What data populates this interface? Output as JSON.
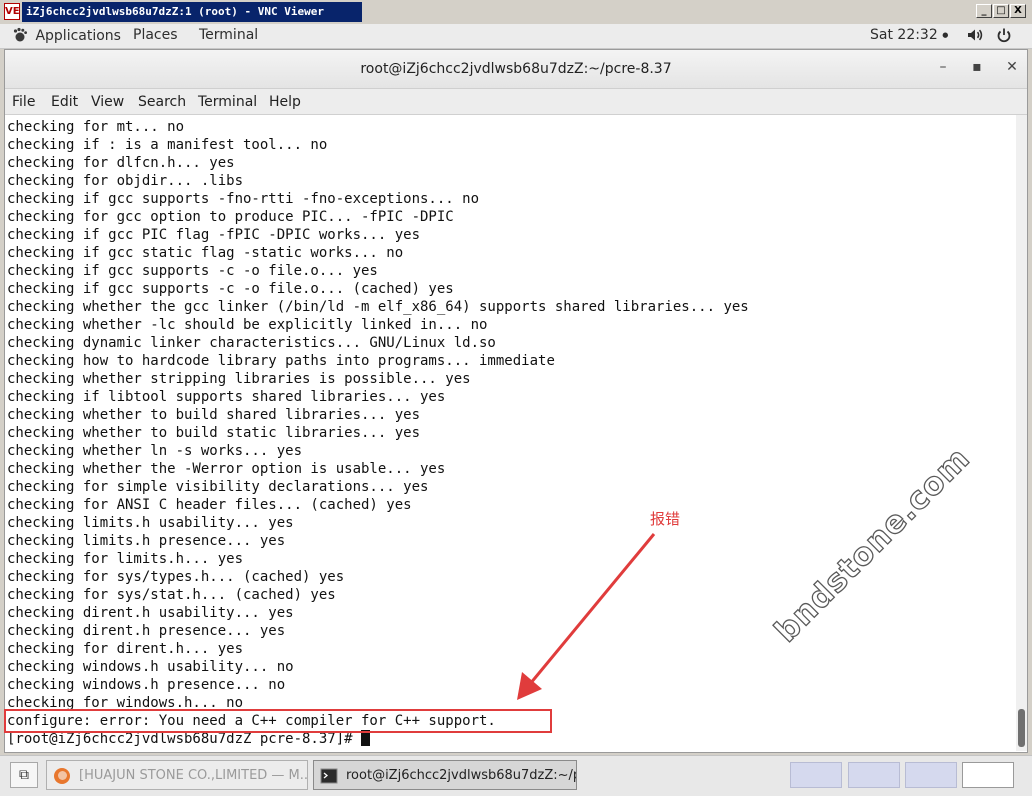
{
  "vnc": {
    "title": "iZj6chcc2jvdlwsb68u7dzZ:1 (root) - VNC Viewer",
    "icon_text": "VE",
    "buttons": {
      "minimize": "_",
      "maximize": "□",
      "close": "X"
    }
  },
  "gnome": {
    "applications": "Applications",
    "places": "Places",
    "terminal": "Terminal",
    "clock": "Sat 22:32",
    "clock_arrow": "●",
    "volume_icon": "🔊",
    "power_icon": "⏻"
  },
  "window": {
    "title": "root@iZj6chcc2jvdlwsb68u7dzZ:~/pcre-8.37",
    "controls": {
      "minimize": "–",
      "maximize": "▪",
      "close": "✕"
    }
  },
  "menu": [
    "File",
    "Edit",
    "View",
    "Search",
    "Terminal",
    "Help"
  ],
  "terminal": {
    "lines": [
      "checking for mt... no",
      "checking if : is a manifest tool... no",
      "checking for dlfcn.h... yes",
      "checking for objdir... .libs",
      "checking if gcc supports -fno-rtti -fno-exceptions... no",
      "checking for gcc option to produce PIC... -fPIC -DPIC",
      "checking if gcc PIC flag -fPIC -DPIC works... yes",
      "checking if gcc static flag -static works... no",
      "checking if gcc supports -c -o file.o... yes",
      "checking if gcc supports -c -o file.o... (cached) yes",
      "checking whether the gcc linker (/bin/ld -m elf_x86_64) supports shared libraries... yes",
      "checking whether -lc should be explicitly linked in... no",
      "checking dynamic linker characteristics... GNU/Linux ld.so",
      "checking how to hardcode library paths into programs... immediate",
      "checking whether stripping libraries is possible... yes",
      "checking if libtool supports shared libraries... yes",
      "checking whether to build shared libraries... yes",
      "checking whether to build static libraries... yes",
      "checking whether ln -s works... yes",
      "checking whether the -Werror option is usable... yes",
      "checking for simple visibility declarations... yes",
      "checking for ANSI C header files... (cached) yes",
      "checking limits.h usability... yes",
      "checking limits.h presence... yes",
      "checking for limits.h... yes",
      "checking for sys/types.h... (cached) yes",
      "checking for sys/stat.h... (cached) yes",
      "checking dirent.h usability... yes",
      "checking dirent.h presence... yes",
      "checking for dirent.h... yes",
      "checking windows.h usability... no",
      "checking windows.h presence... no",
      "checking for windows.h... no",
      "configure: error: You need a C++ compiler for C++ support."
    ],
    "prompt": "[root@iZj6chcc2jvdlwsb68u7dzZ pcre-8.37]# "
  },
  "annotation": {
    "label": "报错",
    "watermark": "bndstone.com",
    "color": "#e03c3c"
  },
  "taskbar": {
    "show_desktop_icon": "⧉",
    "firefox_label": "[HUAJUN STONE CO.,LIMITED — M...",
    "terminal_label": "root@iZj6chcc2jvdlwsb68u7dzZ:~/p..."
  }
}
